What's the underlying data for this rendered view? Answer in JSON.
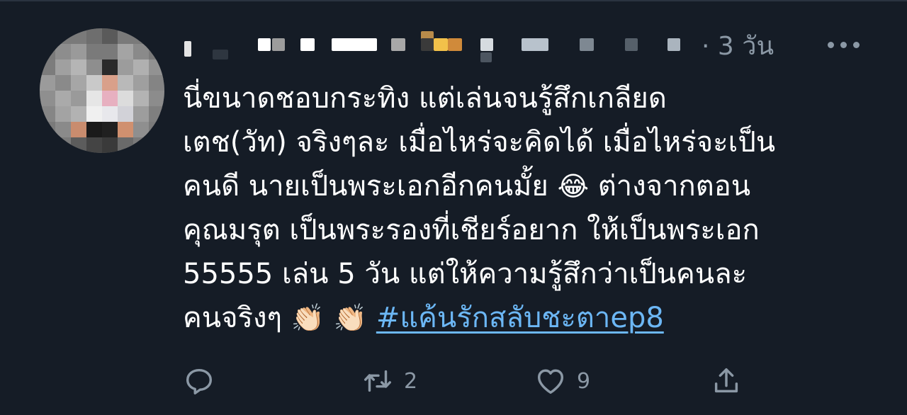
{
  "tweet": {
    "timestamp": "· 3 วัน",
    "line1": "นี่ขนาดชอบกระทิง แต่เล่นจนรู้สึกเกลียด",
    "line2": "เตช(วัท) จริงๆละ เมื่อไหร่จะคิดได้ เมื่อไหร่จะเป็น",
    "line3a": "คนดี นายเป็นพระเอกอีกคนมั้ย",
    "laugh_emoji": "😂",
    "line3b": "ต่างจากตอน",
    "line4": "คุณมรุต เป็นพระรองที่เชียร์อยาก ให้เป็นพระเอก",
    "line5": "55555 เล่น 5 วัน แต่ให้ความรู้สึกว่าเป็นคนละ",
    "line6": "คนจริงๆ",
    "clap_emoji": "👏🏻",
    "hashtag": "#แค้นรักสลับชะตาep8"
  },
  "actions": {
    "reply": {
      "icon": "reply-icon",
      "count": ""
    },
    "retweet": {
      "icon": "retweet-icon",
      "count": "2"
    },
    "like": {
      "icon": "heart-icon",
      "count": "9"
    },
    "share": {
      "icon": "share-icon"
    }
  },
  "colors": {
    "background": "#151c26",
    "text": "#ffffff",
    "muted": "#8b98a5",
    "link": "#6cb7f5"
  }
}
